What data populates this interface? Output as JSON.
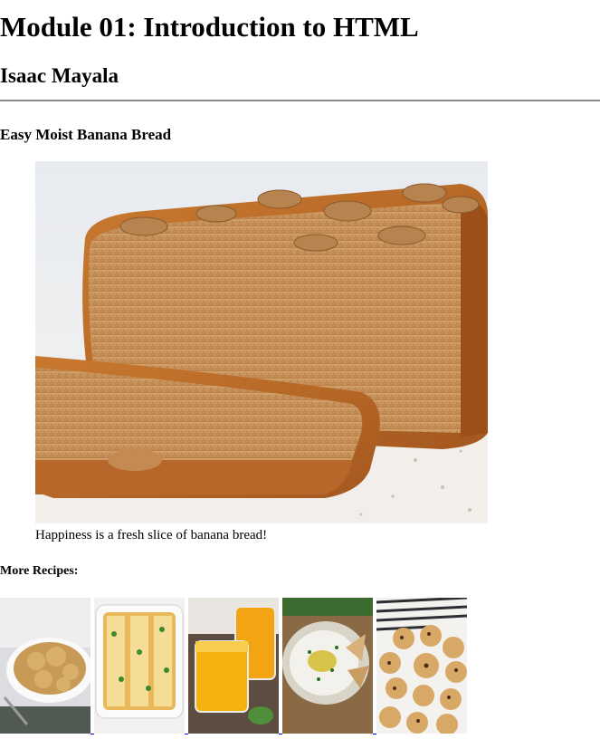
{
  "page": {
    "title": "Module 01: Introduction to HTML",
    "author": "Isaac Mayala"
  },
  "recipe": {
    "heading": "Easy Moist Banana Bread",
    "image_subject": "banana bread loaf with walnuts",
    "caption": "Happiness is a fresh slice of banana bread!"
  },
  "more_recipes": {
    "heading": "More Recipes:",
    "items": [
      {
        "subject": "chicken and dumplings casserole"
      },
      {
        "subject": "chicken enchiladas"
      },
      {
        "subject": "orange juice in jars"
      },
      {
        "subject": "whipped feta dip with chips"
      },
      {
        "subject": "chocolate chip cookies"
      }
    ]
  }
}
